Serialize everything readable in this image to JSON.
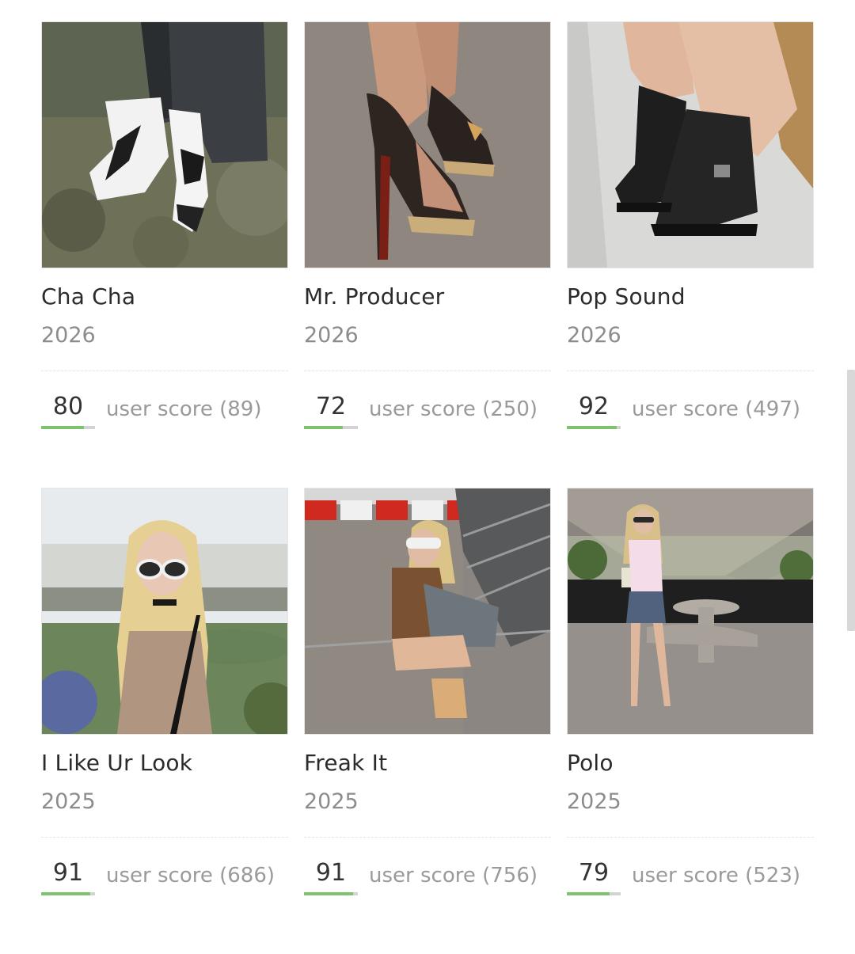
{
  "albums": [
    {
      "title": "Cha Cha",
      "year": "2026",
      "score": "80",
      "score_fraction": 0.8,
      "user_score_label": "user score (89)",
      "cover": "feet-in-white-heels-on-grass"
    },
    {
      "title": "Mr. Producer",
      "year": "2026",
      "score": "72",
      "score_fraction": 0.72,
      "user_score_label": "user score (250)",
      "cover": "feet-in-brown-peep-toe-heels"
    },
    {
      "title": "Pop Sound",
      "year": "2026",
      "score": "92",
      "score_fraction": 0.92,
      "user_score_label": "user score (497)",
      "cover": "black-leather-boots"
    },
    {
      "title": "I Like Ur Look",
      "year": "2025",
      "score": "91",
      "score_fraction": 0.91,
      "user_score_label": "user score (686)",
      "cover": "blonde-woman-with-sunglasses-by-fountain"
    },
    {
      "title": "Freak It",
      "year": "2025",
      "score": "91",
      "score_fraction": 0.91,
      "user_score_label": "user score (756)",
      "cover": "blonde-woman-crouching-with-handbag"
    },
    {
      "title": "Polo",
      "year": "2025",
      "score": "79",
      "score_fraction": 0.79,
      "user_score_label": "user score (523)",
      "cover": "blonde-woman-standing-under-concrete-shelter"
    }
  ],
  "colors": {
    "score_bar_fill": "#7ec36f",
    "score_bar_track": "#d3d3d3",
    "title_text": "#2b2b2b",
    "muted_text": "#8c8c8c"
  }
}
